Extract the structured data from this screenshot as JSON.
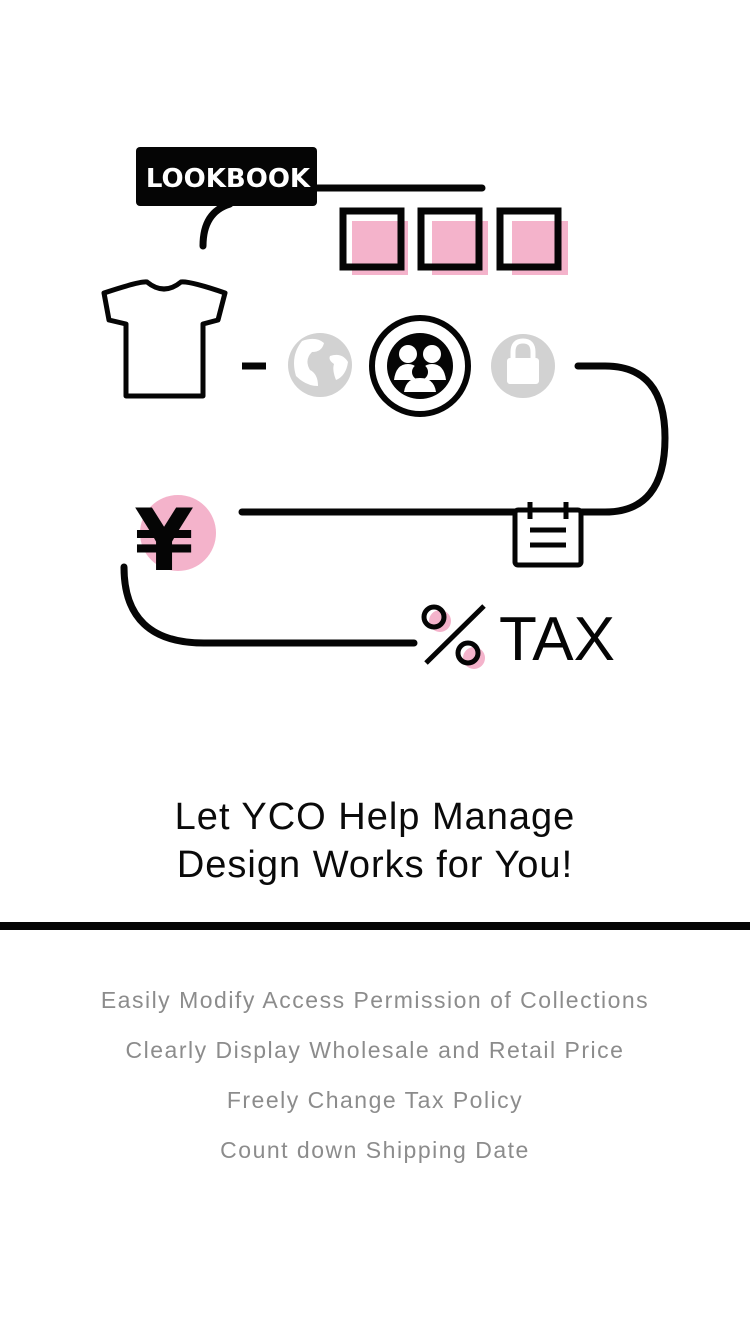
{
  "illustration": {
    "lookbook_label": "LOOKBOOK",
    "yen_symbol": "¥",
    "percent_symbol": "%",
    "tax_label": "TAX",
    "icons": [
      "tshirt-icon",
      "globe-icon",
      "group-icon",
      "lock-icon",
      "yen-icon",
      "calendar-icon",
      "percent-icon"
    ]
  },
  "headline": {
    "line1": "Let YCO Help Manage",
    "line2": "Design Works for You!"
  },
  "features": [
    "Easily Modify Access Permission of Collections",
    "Clearly Display Wholesale and Retail Price",
    "Freely Change Tax Policy",
    "Count down Shipping Date"
  ],
  "colors": {
    "accent_pink": "#f4b3cb",
    "ink": "#050505",
    "muted_gray": "#cfcfcf",
    "text_gray": "#8c8c8c"
  }
}
